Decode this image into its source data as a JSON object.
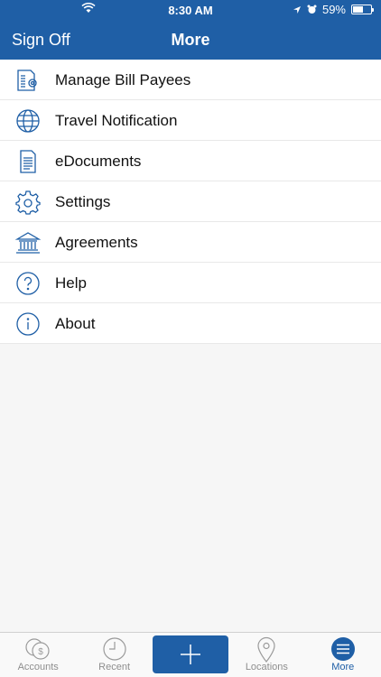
{
  "status": {
    "time": "8:30 AM",
    "battery": "59%",
    "battery_level": 0.59
  },
  "nav": {
    "left_label": "Sign Off",
    "title": "More"
  },
  "menu": [
    {
      "label": "Manage Bill Payees",
      "icon": "bill-payees-icon"
    },
    {
      "label": "Travel Notification",
      "icon": "globe-icon"
    },
    {
      "label": "eDocuments",
      "icon": "document-icon"
    },
    {
      "label": "Settings",
      "icon": "gear-icon"
    },
    {
      "label": "Agreements",
      "icon": "bank-icon"
    },
    {
      "label": "Help",
      "icon": "question-icon"
    },
    {
      "label": "About",
      "icon": "info-icon"
    }
  ],
  "tabs": [
    {
      "label": "Accounts",
      "icon": "coins-icon"
    },
    {
      "label": "Recent",
      "icon": "clock-icon"
    },
    {
      "label": "",
      "icon": "plus-icon"
    },
    {
      "label": "Locations",
      "icon": "location-pin-icon"
    },
    {
      "label": "More",
      "icon": "menu-icon",
      "active": true
    }
  ],
  "colors": {
    "brand": "#1f5fa6",
    "background": "#f6f6f6",
    "inactive_tab": "#8e8e8e"
  }
}
